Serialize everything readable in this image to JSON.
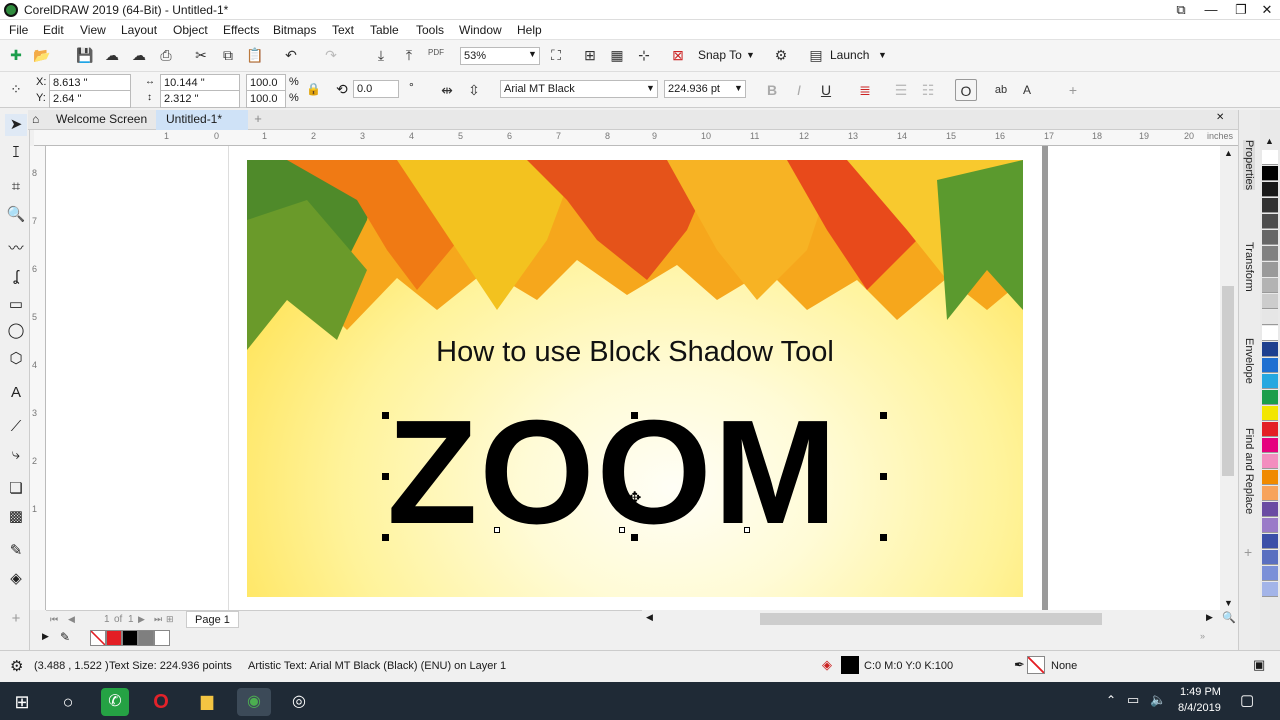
{
  "window": {
    "title": "CorelDRAW 2019 (64-Bit) - Untitled-1*"
  },
  "menu": [
    "File",
    "Edit",
    "View",
    "Layout",
    "Object",
    "Effects",
    "Bitmaps",
    "Text",
    "Table",
    "Tools",
    "Window",
    "Help"
  ],
  "standard_toolbar": {
    "zoom": "53%",
    "snap_to": "Snap To",
    "launch": "Launch",
    "pdf": "PDF"
  },
  "property_bar": {
    "x_label": "X:",
    "x": "8.613 \"",
    "y_label": "Y:",
    "y": "2.64 \"",
    "width": "10.144 \"",
    "height": "2.312 \"",
    "scale_w": "100.0",
    "scale_h": "100.0",
    "pct": "%",
    "rotation": "0.0",
    "degree": "°",
    "font": "Arial MT Black",
    "font_size": "224.936 pt"
  },
  "tabs": {
    "welcome": "Welcome Screen",
    "doc": "Untitled-1*",
    "add": "+"
  },
  "ruler": {
    "unit": "inches",
    "h_ticks": [
      "1",
      "0",
      "1",
      "2",
      "3",
      "4",
      "5",
      "6",
      "7",
      "8",
      "9",
      "10",
      "11",
      "12",
      "13",
      "14",
      "15",
      "16",
      "17",
      "18",
      "19",
      "20"
    ],
    "v_ticks": [
      "8",
      "7",
      "6",
      "5",
      "4",
      "3",
      "2",
      "1"
    ]
  },
  "artwork": {
    "heading": "How to use Block Shadow Tool",
    "main_text": "ZOOM"
  },
  "dockers": [
    "Properties",
    "Transform",
    "Envelope",
    "Find and Replace"
  ],
  "palette_colors": [
    "#ffffff",
    "#000000",
    "#1a1a1a",
    "#333333",
    "#4d4d4d",
    "#666666",
    "#808080",
    "#999999",
    "#b3b3b3",
    "#cccccc",
    "#e6e6e6",
    "#ffffff",
    "#1e3f8f",
    "#1f6fd1",
    "#27a8e0",
    "#1b9e4b",
    "#f3e600",
    "#e31e24",
    "#e5007e",
    "#f28dbf",
    "#f08a00",
    "#f7a35c",
    "#6a4ca3",
    "#9a7bc8",
    "#3b4fa8",
    "#5a6fc0",
    "#7b90d8",
    "#a3b4e8"
  ],
  "page_nav": {
    "current": "1",
    "of": "of",
    "total": "1",
    "page_tab": "Page 1"
  },
  "status": {
    "coords": "(3.488 , 1.522 )",
    "text_size": "Text Size: 224.936 points",
    "object_info": "Artistic Text: Arial MT Black (Black) (ENU) on Layer 1",
    "fill": "C:0 M:0 Y:0 K:100",
    "outline": "None"
  },
  "taskbar": {
    "time": "1:49 PM",
    "date": "8/4/2019"
  }
}
